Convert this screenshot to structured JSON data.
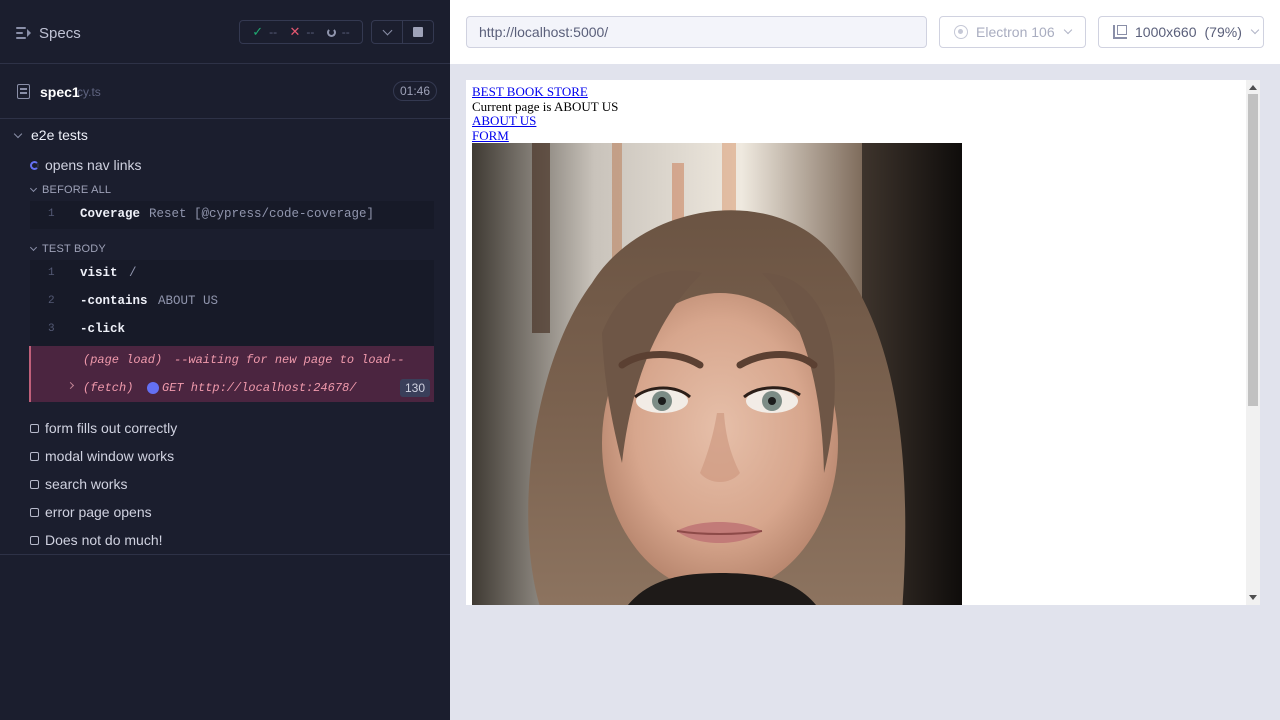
{
  "reporter": {
    "specs_label": "Specs",
    "stats": {
      "passed": "--",
      "failed": "--",
      "pending": "--"
    },
    "spec": {
      "name": "spec1",
      "ext": "cy.ts",
      "duration": "01:46"
    },
    "suite": {
      "title": "e2e tests",
      "running_test": "opens nav links",
      "before_all": {
        "label": "BEFORE ALL",
        "commands": [
          {
            "num": "1",
            "name": "Coverage",
            "message": "Reset [@cypress/code-coverage]"
          }
        ]
      },
      "test_body": {
        "label": "TEST BODY",
        "commands": [
          {
            "num": "1",
            "name": "visit",
            "message": "/"
          },
          {
            "num": "2",
            "name": "-contains",
            "message": "ABOUT US"
          },
          {
            "num": "3",
            "name": "-click",
            "message": ""
          }
        ]
      },
      "pending": {
        "page_load": {
          "name": "(page load)",
          "message": "--waiting for new page to load--"
        },
        "fetch": {
          "name": "(fetch)",
          "message": "GET http://localhost:24678/",
          "count": "130"
        }
      },
      "other_tests": [
        "form fills out correctly",
        "modal window works",
        "search works",
        "error page opens",
        "Does not do much!"
      ]
    }
  },
  "preview": {
    "url": "http://localhost:5000/",
    "browser": "Electron 106",
    "viewport": "1000x660",
    "zoom": "(79%)"
  },
  "app": {
    "links": {
      "home": "BEST BOOK STORE",
      "about": "ABOUT US",
      "form": "FORM"
    },
    "current_page_text": "Current page is ABOUT US",
    "photo_alt": "portrait photo"
  },
  "colors": {
    "reporter_bg": "#1b1e2e",
    "pass": "#1fa971",
    "fail": "#e45770",
    "accent": "#6470f3",
    "pending_bg": "#4b2540"
  }
}
